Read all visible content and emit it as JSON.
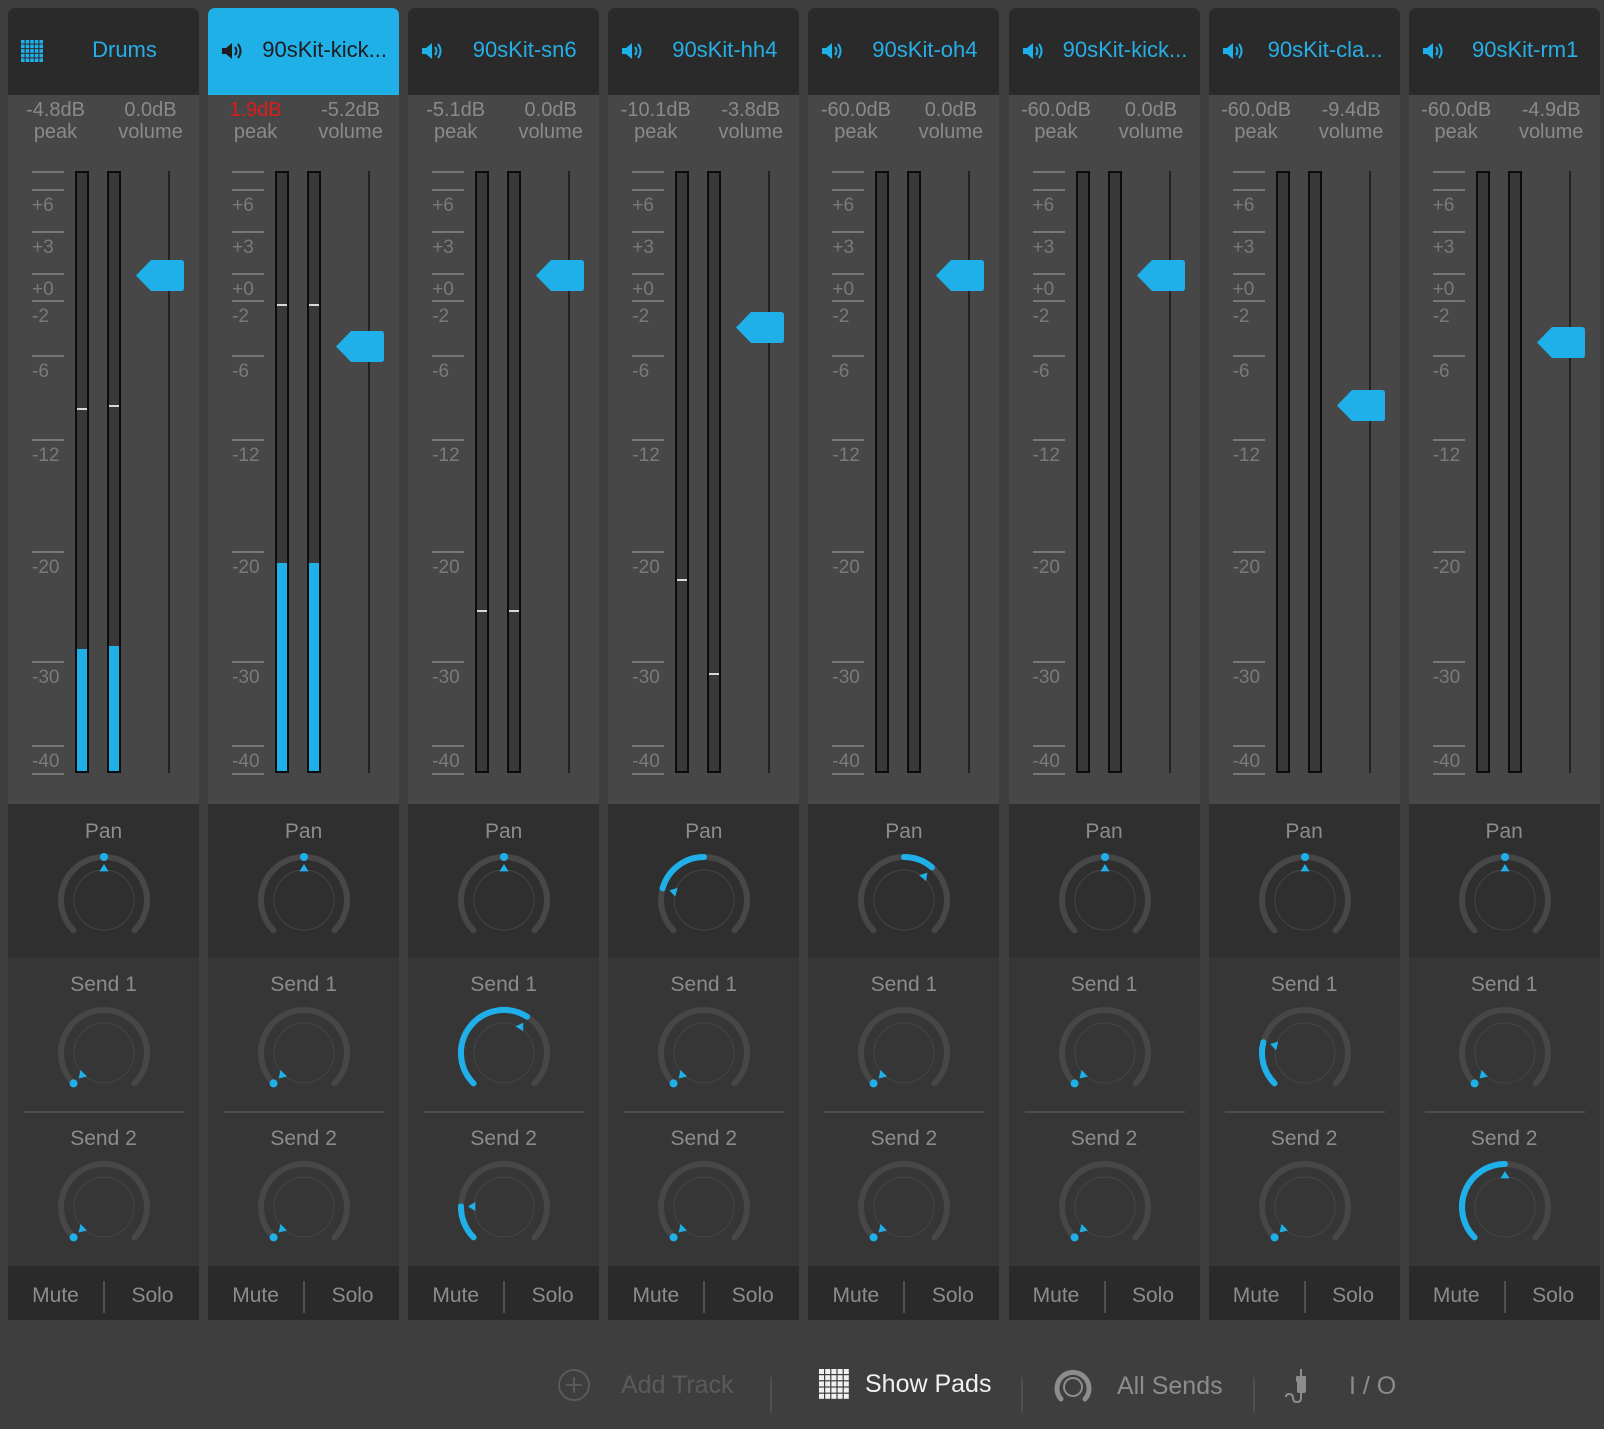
{
  "colors": {
    "accent": "#1fb0ea",
    "clip": "#e01b1b",
    "background": "#3e3e3e",
    "header_bg": "#2a2a2a"
  },
  "scale": {
    "min_db": -44,
    "ticks": [
      {
        "db": 6,
        "label": "+6"
      },
      {
        "db": 3,
        "label": "+3"
      },
      {
        "db": 0,
        "label": "+0"
      },
      {
        "db": -2,
        "label": "-2"
      },
      {
        "db": -6,
        "label": "-6"
      },
      {
        "db": -12,
        "label": "-12"
      },
      {
        "db": -20,
        "label": "-20"
      },
      {
        "db": -30,
        "label": "-30"
      },
      {
        "db": -40,
        "label": "-40"
      }
    ]
  },
  "labels": {
    "peak": "peak",
    "volume": "volume",
    "pan": "Pan",
    "send1": "Send 1",
    "send2": "Send 2",
    "mute": "Mute",
    "solo": "Solo"
  },
  "strips": [
    {
      "name": "Drums",
      "icon": "drum-pads-icon",
      "selected": false,
      "peak": "-4.8dB",
      "peak_clip": false,
      "volume": "0.0dB",
      "volume_db": 0.0,
      "meter_db": [
        -28.5,
        -28.3
      ],
      "peak_hold_db": [
        -9.5,
        -9.3
      ],
      "pan": 0.0,
      "send1": 0.0,
      "send2": 0.0
    },
    {
      "name": "90sKit-kick...",
      "icon": "speaker-icon",
      "selected": true,
      "peak": "1.9dB",
      "peak_clip": true,
      "volume": "-5.2dB",
      "volume_db": -5.2,
      "meter_db": [
        -20.7,
        -20.7
      ],
      "peak_hold_db": [
        -2.0,
        -2.0
      ],
      "pan": 0.0,
      "send1": 0.0,
      "send2": 0.0
    },
    {
      "name": "90sKit-sn6",
      "icon": "speaker-icon",
      "selected": false,
      "peak": "-5.1dB",
      "peak_clip": false,
      "volume": "0.0dB",
      "volume_db": 0.0,
      "meter_db": [
        -60,
        -60
      ],
      "peak_hold_db": [
        -25.0,
        -25.0
      ],
      "pan": 0.0,
      "send1": 0.62,
      "send2": 0.17
    },
    {
      "name": "90sKit-hh4",
      "icon": "speaker-icon",
      "selected": false,
      "peak": "-10.1dB",
      "peak_clip": false,
      "volume": "-3.8dB",
      "volume_db": -3.8,
      "meter_db": [
        -60,
        -60
      ],
      "peak_hold_db": [
        -22.2,
        -31.0
      ],
      "pan": -0.55,
      "send1": 0.0,
      "send2": 0.0
    },
    {
      "name": "90sKit-oh4",
      "icon": "speaker-icon",
      "selected": false,
      "peak": "-60.0dB",
      "peak_clip": false,
      "volume": "0.0dB",
      "volume_db": 0.0,
      "meter_db": [
        -60,
        -60
      ],
      "peak_hold_db": null,
      "pan": 0.3,
      "send1": 0.0,
      "send2": 0.0
    },
    {
      "name": "90sKit-kick...",
      "icon": "speaker-icon",
      "selected": false,
      "peak": "-60.0dB",
      "peak_clip": false,
      "volume": "0.0dB",
      "volume_db": 0.0,
      "meter_db": [
        -60,
        -60
      ],
      "peak_hold_db": null,
      "pan": 0.0,
      "send1": 0.0,
      "send2": 0.0
    },
    {
      "name": "90sKit-cla...",
      "icon": "speaker-icon",
      "selected": false,
      "peak": "-60.0dB",
      "peak_clip": false,
      "volume": "-9.4dB",
      "volume_db": -9.4,
      "meter_db": [
        -60,
        -60
      ],
      "peak_hold_db": null,
      "pan": 0.0,
      "send1": 0.22,
      "send2": 0.0
    },
    {
      "name": "90sKit-rm1",
      "icon": "speaker-icon",
      "selected": false,
      "peak": "-60.0dB",
      "peak_clip": false,
      "volume": "-4.9dB",
      "volume_db": -4.9,
      "meter_db": [
        -60,
        -60
      ],
      "peak_hold_db": null,
      "pan": 0.0,
      "send1": 0.0,
      "send2": 0.5
    }
  ],
  "toolbar": {
    "add_track": "Add Track",
    "show_pads": "Show Pads",
    "all_sends": "All Sends",
    "io": "I / O"
  }
}
